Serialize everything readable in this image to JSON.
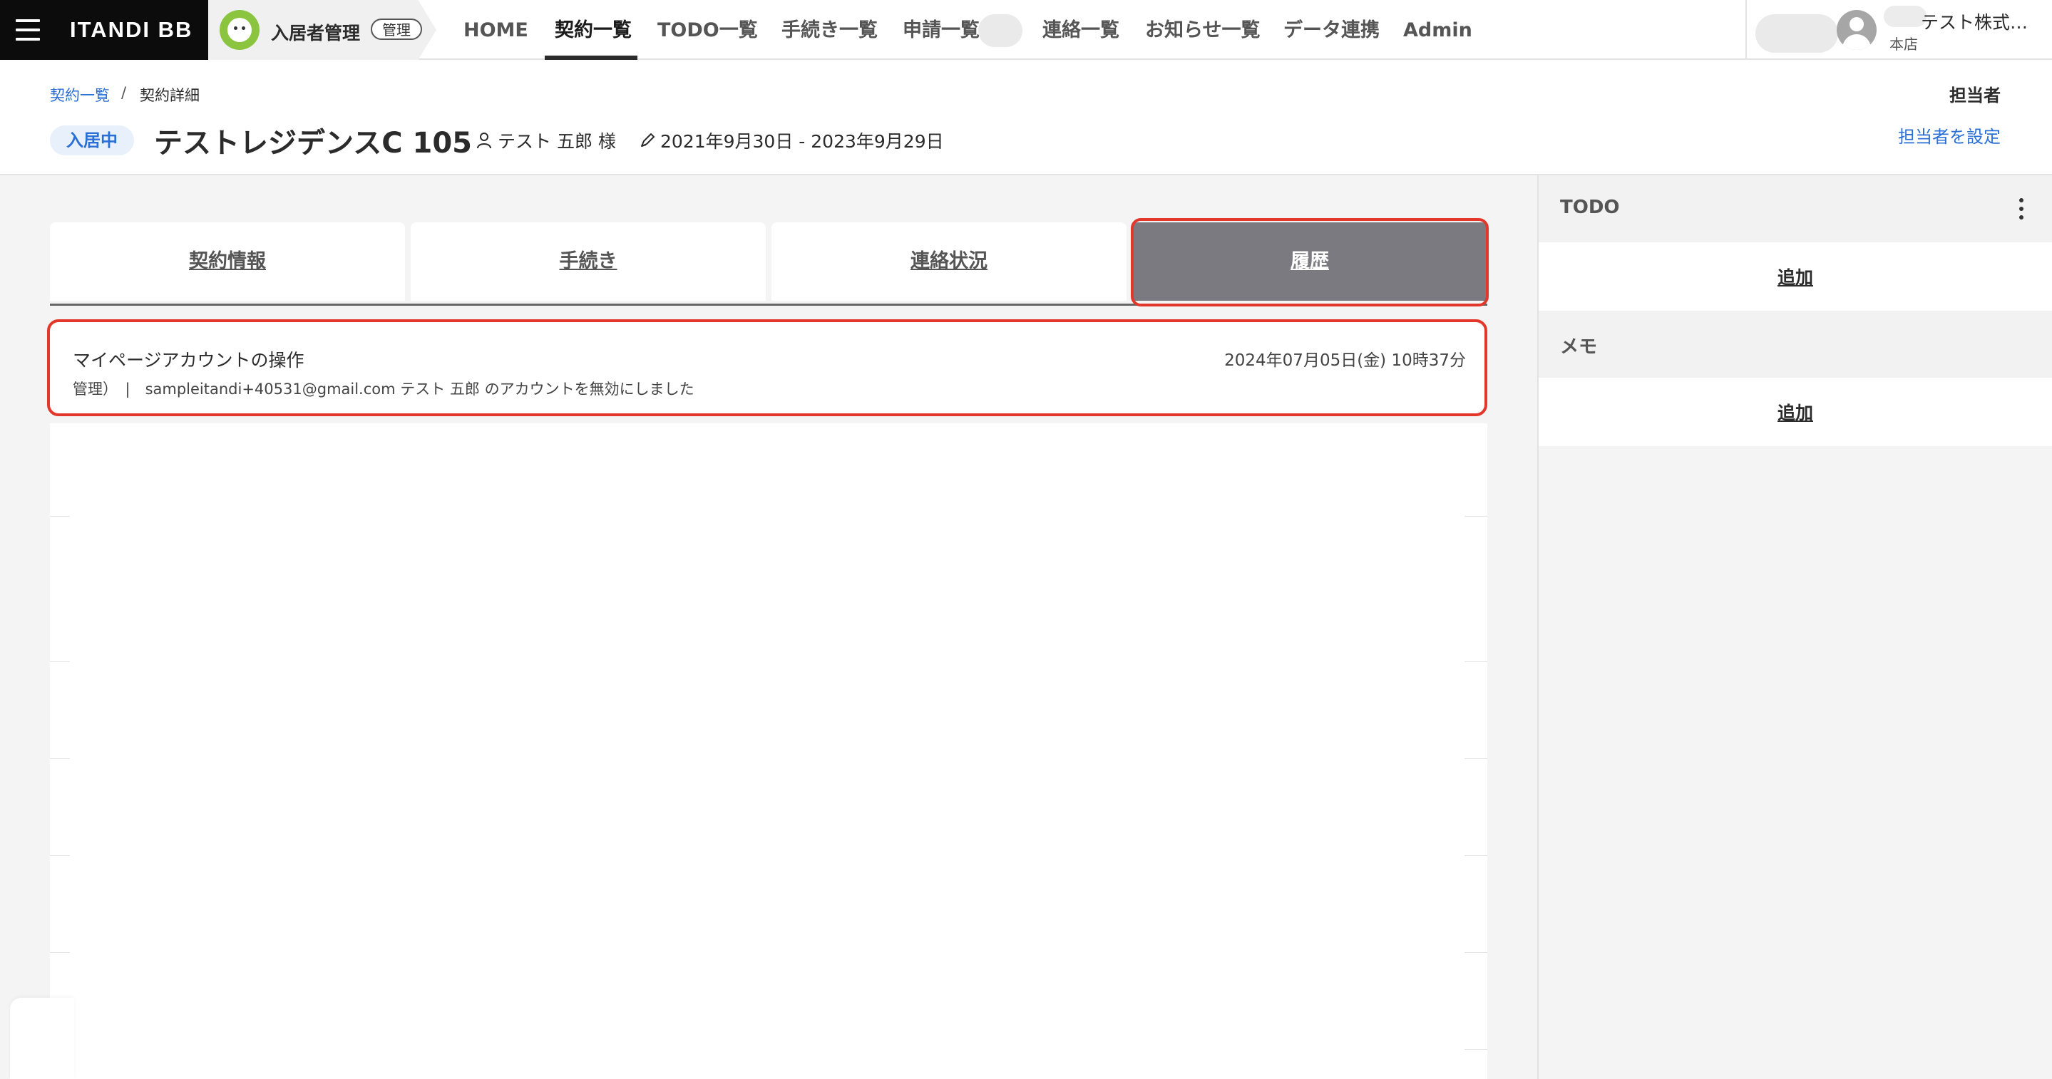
{
  "brand": {
    "name": "ITANDI BB"
  },
  "app": {
    "name": "入居者管理",
    "badge": "管理"
  },
  "nav": {
    "items": [
      "HOME",
      "契約一覧",
      "TODO一覧",
      "手続き一覧",
      "申請一覧",
      "連絡一覧",
      "お知らせ一覧",
      "データ連携",
      "Admin"
    ],
    "active": "契約一覧"
  },
  "user": {
    "company": "テスト株式…",
    "branch": "本店"
  },
  "breadcrumb": {
    "parent": "契約一覧",
    "separator": "/",
    "current": "契約詳細"
  },
  "contract": {
    "status": "入居中",
    "title": "テストレジデンスC 105",
    "tenant": "テスト 五郎 様",
    "period": "2021年9月30日 - 2023年9月29日"
  },
  "assignee": {
    "label": "担当者",
    "action": "担当者を設定"
  },
  "tabs": {
    "items": [
      "契約情報",
      "手続き",
      "連絡状況",
      "履歴"
    ],
    "active": "履歴"
  },
  "history": {
    "title": "マイページアカウントの操作",
    "datetime": "2024年07月05日(金) 10時37分",
    "detail": "管理）　|　sampleitandi+40531@gmail.com テスト 五郎 のアカウントを無効にしました"
  },
  "sidebar": {
    "todo": {
      "title": "TODO",
      "add": "追加"
    },
    "memo": {
      "title": "メモ",
      "add": "追加"
    }
  },
  "colors": {
    "accent_link": "#2a6fd6",
    "highlight": "#e2372a",
    "active_tab": "#7a7a80"
  }
}
